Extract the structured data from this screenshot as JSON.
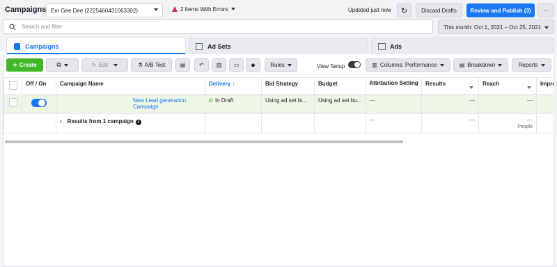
{
  "header": {
    "title": "Campaigns",
    "account": "Em Gee Dee (2225460431063302)",
    "errors": "2 Items With Errors",
    "status": "Updated just now",
    "discard": "Discard Drafts",
    "publish": "Review and Publish (3)",
    "more": "···"
  },
  "search": {
    "placeholder": "Search and filter"
  },
  "date_range": "This month: Oct 1, 2021 – Oct 25, 2021",
  "tabs": [
    {
      "label": "Campaigns"
    },
    {
      "label": "Ad Sets"
    },
    {
      "label": "Ads"
    }
  ],
  "toolbar": {
    "create": "Create",
    "edit": "Edit",
    "ab_test": "A/B Test",
    "rules": "Rules",
    "view_setup": "View Setup",
    "columns": "Columns: Performance",
    "breakdown": "Breakdown",
    "reports": "Reports"
  },
  "table": {
    "headers": [
      "Off / On",
      "Campaign Name",
      "Delivery ↑",
      "Bid Strategy",
      "Budget",
      "Attribution Setting",
      "Results",
      "Reach",
      "Impress"
    ],
    "row": {
      "name": "New Lead generation Campaign",
      "delivery": "In Draft",
      "bid": "Using ad set bi...",
      "budget": "Using ad set bu...",
      "attribution": "—",
      "results": "—",
      "reach": "—"
    },
    "summary": {
      "label": "Results from 1 campaign",
      "attribution": "—",
      "results": "—",
      "reach": "—",
      "reach_sub": "People"
    }
  },
  "colors": {
    "accent": "#1877f2",
    "create": "#42b72a",
    "error": "#e0245e"
  }
}
